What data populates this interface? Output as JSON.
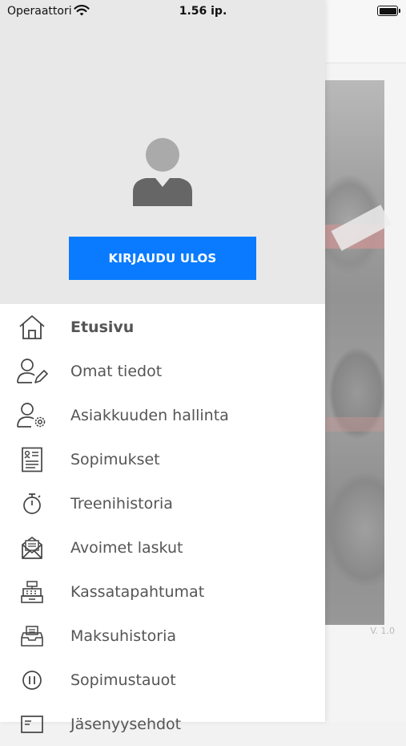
{
  "status_bar": {
    "carrier": "Operaattori",
    "time": "1.56 ip."
  },
  "drawer": {
    "logout_label": "KIRJAUDU ULOS",
    "menu": [
      {
        "label": "Etusivu",
        "icon": "home-icon",
        "active": true
      },
      {
        "label": "Omat tiedot",
        "icon": "user-edit-icon",
        "active": false
      },
      {
        "label": "Asiakkuuden hallinta",
        "icon": "user-settings-icon",
        "active": false
      },
      {
        "label": "Sopimukset",
        "icon": "contract-icon",
        "active": false
      },
      {
        "label": "Treenihistoria",
        "icon": "stopwatch-icon",
        "active": false
      },
      {
        "label": "Avoimet laskut",
        "icon": "envelope-icon",
        "active": false
      },
      {
        "label": "Kassatapahtumat",
        "icon": "cash-register-icon",
        "active": false
      },
      {
        "label": "Maksuhistoria",
        "icon": "payment-tray-icon",
        "active": false
      },
      {
        "label": "Sopimustauot",
        "icon": "pause-icon",
        "active": false
      },
      {
        "label": "Jäsenyysehdot",
        "icon": "card-icon",
        "active": false
      }
    ]
  },
  "background": {
    "version": "V. 1.0"
  },
  "colors": {
    "accent": "#0a7bff",
    "header_bg": "#e8e8e8",
    "menu_text": "#555555",
    "icon_stroke": "#444444"
  }
}
